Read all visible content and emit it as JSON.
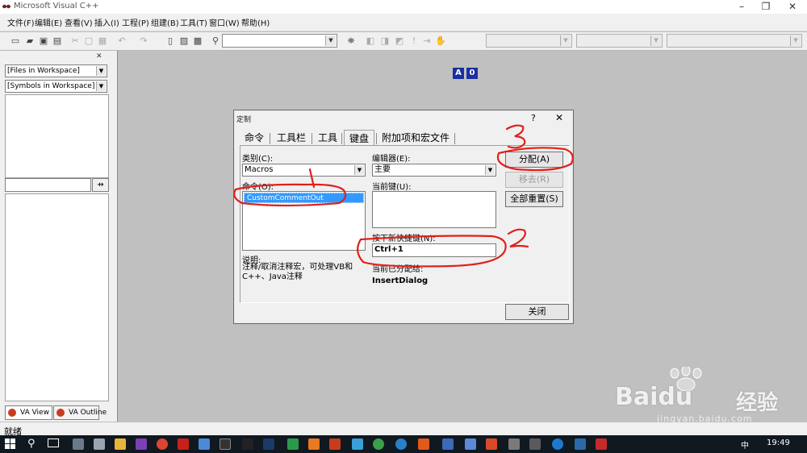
{
  "window": {
    "title": "Microsoft Visual C++"
  },
  "menu": [
    "文件(F)",
    "编辑(E)",
    "查看(V)",
    "插入(I)",
    "工程(P)",
    "组建(B)",
    "工具(T)",
    "窗口(W)",
    "帮助(H)"
  ],
  "toolbar": {
    "find_combo_value": "",
    "a_label": "A",
    "zero_label": "0"
  },
  "workspace": {
    "combo_files": "[Files in Workspace]",
    "combo_symbols": "[Symbols in Workspace]",
    "tabs": [
      "VA View",
      "VA Outline"
    ]
  },
  "dialog": {
    "title": "定制",
    "help": "?",
    "close": "✕",
    "tabs": [
      "命令",
      "工具栏",
      "工具",
      "键盘",
      "附加项和宏文件"
    ],
    "active_tab": "键盘",
    "category_label": "类别(C):",
    "category_value": "Macros",
    "command_label": "命令(O):",
    "commands": [
      "CustomCommentOut"
    ],
    "description_label": "说明:",
    "description_text": "注释/取消注释宏，可处理VB和C++、Java注释",
    "editor_label": "编辑器(E):",
    "editor_value": "主要",
    "current_keys_label": "当前键(U):",
    "new_shortcut_label": "按下新快捷键(N):",
    "new_shortcut_value": "Ctrl+1",
    "assigned_to_label": "当前已分配给:",
    "assigned_to_value": "InsertDialog",
    "buttons": {
      "assign": "分配(A)",
      "remove": "移去(R)",
      "reset_all": "全部重置(S)",
      "close": "关闭"
    }
  },
  "annotations": [
    "1",
    "2",
    "3"
  ],
  "status": {
    "text": "就绪"
  },
  "taskbar": {
    "clock": "19:49",
    "ime": "中"
  },
  "watermark": {
    "brand": "Baidu",
    "cn": "经验",
    "url": "jingyan.baidu.com"
  },
  "colors": {
    "selection": "#3399ff",
    "annotation": "#e0201a",
    "taskbar": "#101820"
  }
}
